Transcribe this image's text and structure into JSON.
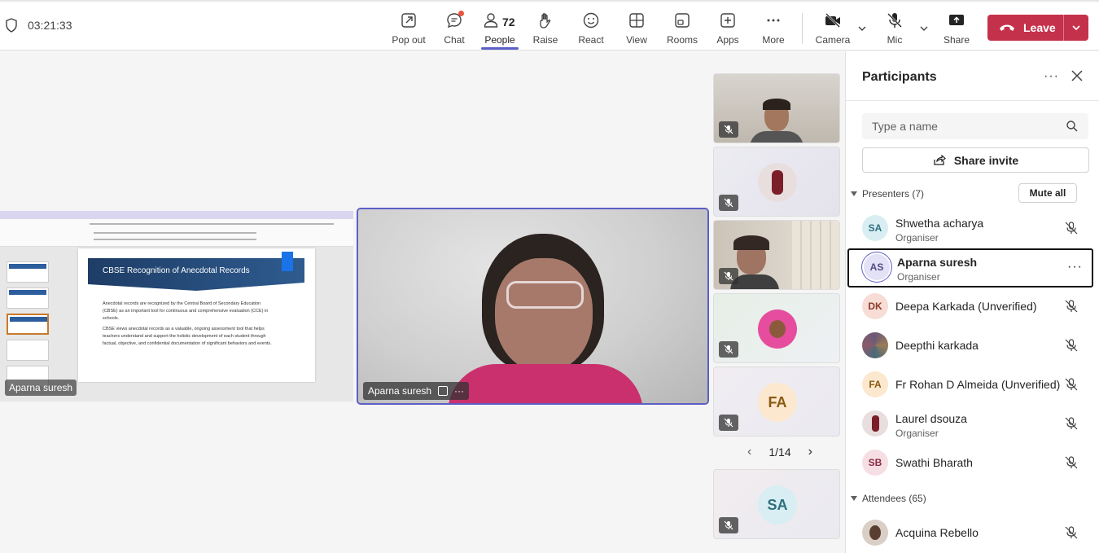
{
  "meeting": {
    "timer": "03:21:33",
    "people_count": "72"
  },
  "toolbar": {
    "popout": "Pop out",
    "chat": "Chat",
    "people": "People",
    "raise": "Raise",
    "react": "React",
    "view": "View",
    "rooms": "Rooms",
    "apps": "Apps",
    "more": "More",
    "camera": "Camera",
    "mic": "Mic",
    "share": "Share",
    "leave": "Leave"
  },
  "stage": {
    "shared_screen_owner": "Aparna suresh",
    "slide_title": "CBSE Recognition of Anecdotal Records",
    "slide_bullets": [
      "Anecdotal records are recognized by the Central Board of Secondary Education (CBSE) as an important tool for continuous and comprehensive evaluation (CCE) in schools.",
      "CBSE views anecdotal records as a valuable, ongoing assessment tool that helps teachers understand and support the holistic development of each student through factual, objective, and confidential documentation of significant behaviors and events."
    ],
    "main_speaker": "Aparna suresh",
    "tile_initials_fa": "FA",
    "tile_initials_sa": "SA",
    "pager": "1/14"
  },
  "panel": {
    "title": "Participants",
    "search_placeholder": "Type a name",
    "share_invite": "Share invite",
    "presenters_header": "Presenters (7)",
    "mute_all": "Mute all",
    "attendees_header": "Attendees (65)",
    "presenters": [
      {
        "initials": "SA",
        "name": "Shwetha acharya",
        "role": "Organiser",
        "bg": "#d8eef3",
        "fg": "#2f6f80"
      },
      {
        "initials": "AS",
        "name": "Aparna suresh",
        "role": "Organiser",
        "bg": "#e3e1f5",
        "fg": "#4f4a8a"
      },
      {
        "initials": "DK",
        "name": "Deepa Karkada (Unverified)",
        "role": "",
        "bg": "#f7ddd6",
        "fg": "#8a3b27"
      },
      {
        "initials": "",
        "name": "Deepthi karkada",
        "role": "",
        "bg": "#6b5a78",
        "fg": "#ffffff"
      },
      {
        "initials": "FA",
        "name": "Fr Rohan D Almeida (Unverified)",
        "role": "",
        "bg": "#fbe8cf",
        "fg": "#8a5a12"
      },
      {
        "initials": "",
        "name": "Laurel dsouza",
        "role": "Organiser",
        "bg": "#e9dede",
        "fg": "#7a2a2a"
      },
      {
        "initials": "SB",
        "name": "Swathi Bharath",
        "role": "",
        "bg": "#f6dfe4",
        "fg": "#8a2a45"
      }
    ],
    "attendees": [
      {
        "initials": "",
        "name": "Acquina Rebello",
        "role": "",
        "bg": "#d9cfc6",
        "fg": "#333333"
      }
    ]
  }
}
